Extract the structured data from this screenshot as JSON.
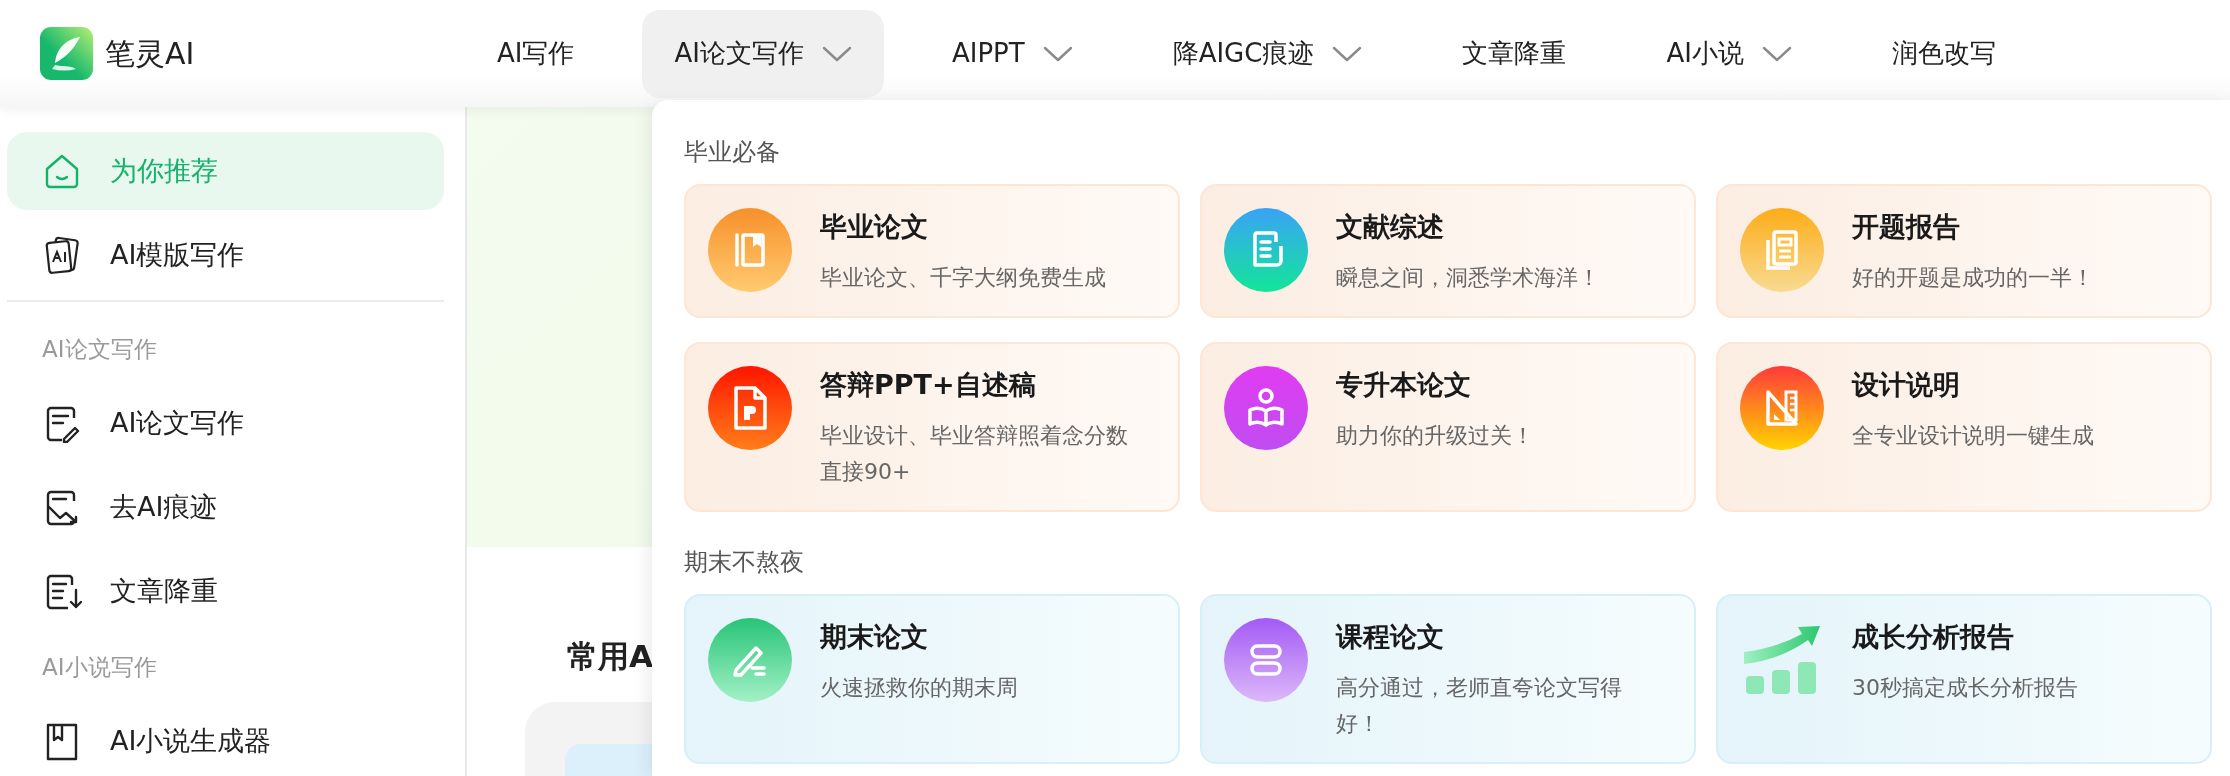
{
  "header": {
    "logo": {
      "text": "笔灵AI"
    },
    "nav": [
      {
        "label": "AI写作",
        "dropdown": false,
        "selected": false
      },
      {
        "label": "AI论文写作",
        "dropdown": true,
        "selected": true
      },
      {
        "label": "AIPPT",
        "dropdown": true,
        "selected": false
      },
      {
        "label": "降AIGC痕迹",
        "dropdown": true,
        "selected": false
      },
      {
        "label": "文章降重",
        "dropdown": false,
        "selected": false
      },
      {
        "label": "AI小说",
        "dropdown": true,
        "selected": false
      },
      {
        "label": "润色改写",
        "dropdown": false,
        "selected": false
      }
    ]
  },
  "sidebar": {
    "items": [
      {
        "kind": "item",
        "label": "为你推荐",
        "selected": true
      },
      {
        "kind": "item",
        "label": "AI模版写作",
        "selected": false
      },
      {
        "kind": "divider"
      },
      {
        "kind": "section",
        "label": "AI论文写作"
      },
      {
        "kind": "item",
        "label": "AI论文写作",
        "selected": false
      },
      {
        "kind": "item",
        "label": "去AI痕迹",
        "selected": false
      },
      {
        "kind": "item",
        "label": "文章降重",
        "selected": false
      },
      {
        "kind": "section",
        "label": "AI小说写作"
      },
      {
        "kind": "item",
        "label": "AI小说生成器",
        "selected": false
      }
    ]
  },
  "main": {
    "heading": "常用A"
  },
  "dropdown": {
    "sections": [
      {
        "title": "毕业必备",
        "cards": [
          {
            "title": "毕业论文",
            "description": "毕业论文、千字大纲免费生成"
          },
          {
            "title": "文献综述",
            "description": "瞬息之间，洞悉学术海洋！"
          },
          {
            "title": "开题报告",
            "description": "好的开题是成功的一半！"
          },
          {
            "title": "答辩PPT+自述稿",
            "description": "毕业设计、毕业答辩照着念分数直接90+"
          },
          {
            "title": "专升本论文",
            "description": "助力你的升级过关！"
          },
          {
            "title": "设计说明",
            "description": "全专业设计说明一键生成"
          }
        ]
      },
      {
        "title": "期末不熬夜",
        "cards": [
          {
            "title": "期末论文",
            "description": "火速拯救你的期末周"
          },
          {
            "title": "课程论文",
            "description": "高分通过，老师直夸论文写得好！"
          },
          {
            "title": "成长分析报告",
            "description": "30秒搞定成长分析报告"
          }
        ]
      }
    ]
  }
}
